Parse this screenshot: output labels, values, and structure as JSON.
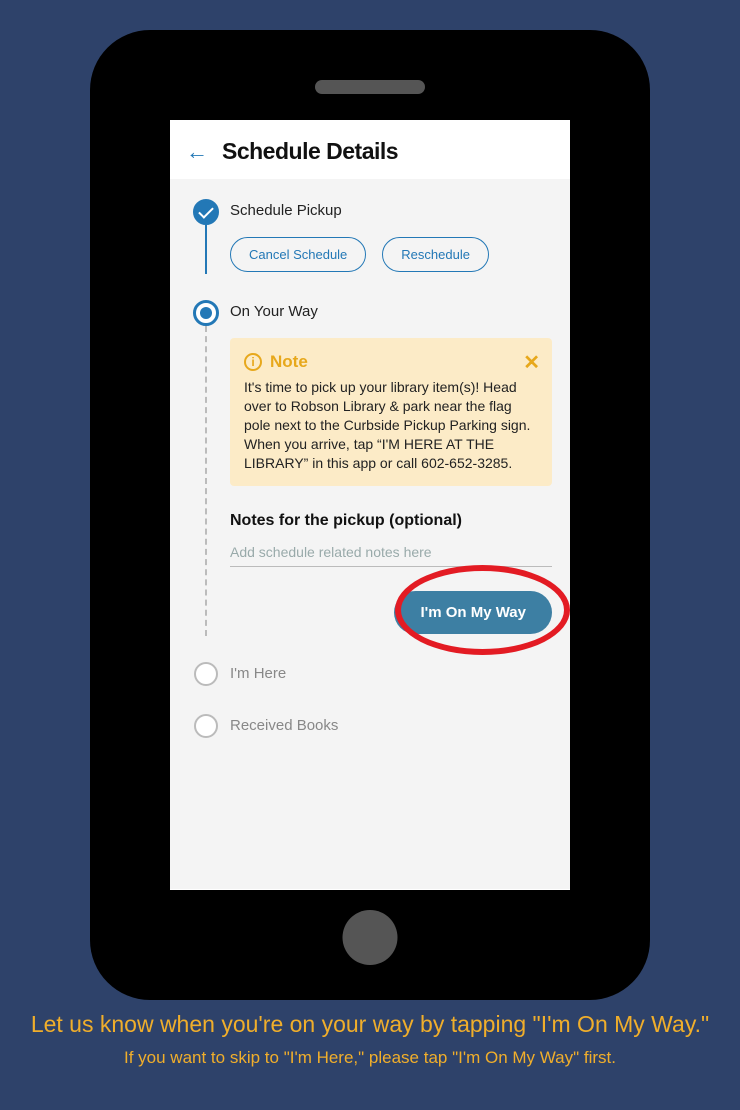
{
  "header": {
    "title": "Schedule Details"
  },
  "steps": {
    "pickup": {
      "title": "Schedule Pickup",
      "cancel_label": "Cancel Schedule",
      "reschedule_label": "Reschedule"
    },
    "onway": {
      "title": "On Your Way",
      "note_title": "Note",
      "note_body": "It's time to pick up your library item(s)! Head over to Robson Library & park near the flag pole next to the Curbside Pickup Parking sign. When you arrive, tap “I'M HERE AT THE LIBRARY” in this app or call 602-652-3285.",
      "notes_label": "Notes for the pickup (optional)",
      "notes_placeholder": "Add schedule related notes here",
      "cta_label": "I'm On My Way"
    },
    "here": {
      "title": "I'm Here"
    },
    "received": {
      "title": "Received Books"
    }
  },
  "captions": {
    "line1": "Let us know when you're on your way by tapping \"I'm On My Way.\"",
    "line2": "If you want to skip to \"I'm Here,\" please tap \"I'm On My Way\" first."
  }
}
